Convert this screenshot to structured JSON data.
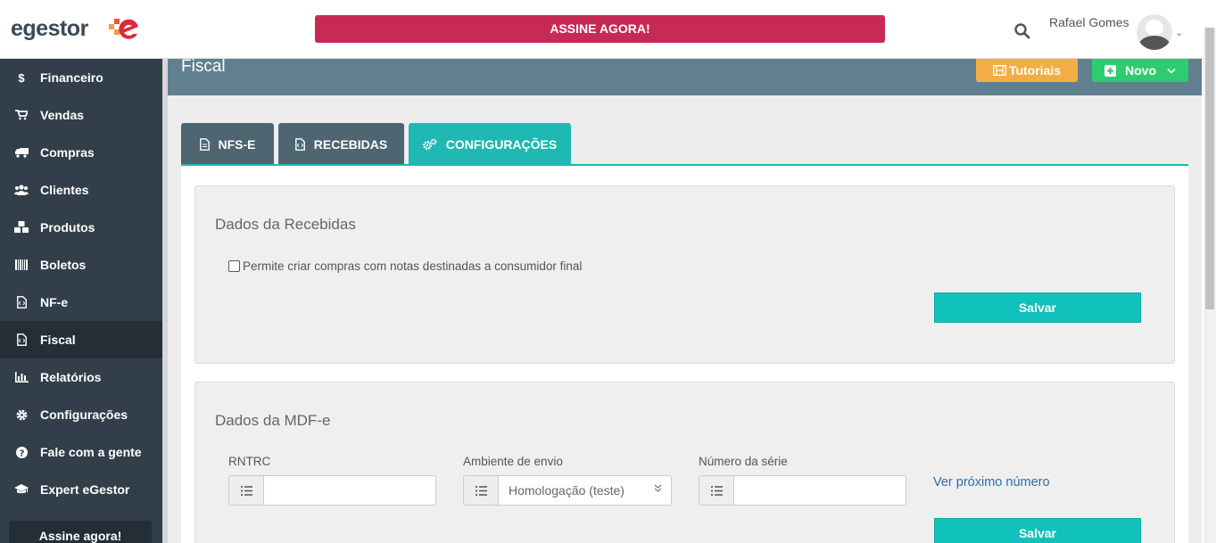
{
  "topbar": {
    "logo_text": "egestor",
    "cta_label": "ASSINE AGORA!",
    "user_name": "Rafael Gomes"
  },
  "sidebar": {
    "items": [
      {
        "label": "Financeiro",
        "icon": "dollar-icon"
      },
      {
        "label": "Vendas",
        "icon": "cart-icon"
      },
      {
        "label": "Compras",
        "icon": "truck-icon"
      },
      {
        "label": "Clientes",
        "icon": "users-icon"
      },
      {
        "label": "Produtos",
        "icon": "cubes-icon"
      },
      {
        "label": "Boletos",
        "icon": "barcode-icon"
      },
      {
        "label": "NF-e",
        "icon": "file-code-icon"
      },
      {
        "label": "Fiscal",
        "icon": "file-code-icon"
      },
      {
        "label": "Relatórios",
        "icon": "bar-chart-icon"
      },
      {
        "label": "Configurações",
        "icon": "gear-icon"
      },
      {
        "label": "Fale com a gente",
        "icon": "question-icon"
      },
      {
        "label": "Expert eGestor",
        "icon": "graduation-cap-icon"
      }
    ],
    "active": "Fiscal",
    "cta_label": "Assine agora!"
  },
  "header": {
    "title": "Fiscal",
    "tutorials_label": "Tutoriais",
    "new_label": "Novo"
  },
  "tabs": [
    {
      "label": "NFS-E"
    },
    {
      "label": "RECEBIDAS"
    },
    {
      "label": "CONFIGURAÇÕES"
    }
  ],
  "active_tab": "CONFIGURAÇÕES",
  "recebidas": {
    "title": "Dados da Recebidas",
    "checkbox_label": "Permite criar compras com notas destinadas a consumidor final",
    "checkbox_checked": false,
    "save_label": "Salvar"
  },
  "mdfe": {
    "title": "Dados da MDF-e",
    "rntrc_label": "RNTRC",
    "rntrc_value": "",
    "ambiente_label": "Ambiente de envio",
    "ambiente_value": "Homologação (teste)",
    "serie_label": "Número da série",
    "serie_value": "",
    "next_number_link": "Ver próximo número",
    "save_label": "Salvar"
  },
  "colors": {
    "sidebar": "#323f4a",
    "sidebar_active": "#232e37",
    "cta": "#c62a55",
    "header": "#61808f",
    "tab_inactive": "#4e6572",
    "tab_active": "#1fb8b2",
    "save": "#10c2bb",
    "tutorials": "#f3ad45",
    "new": "#2ecc71"
  }
}
